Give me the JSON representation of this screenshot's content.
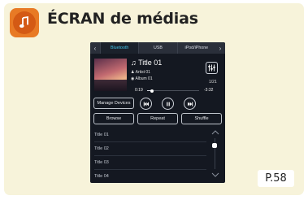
{
  "header": {
    "title": "ÉCRAN de médias",
    "icon": "music-note-icon",
    "icon_color": "#e87a25"
  },
  "screen": {
    "tabs": [
      {
        "label": "Bluetooth",
        "active": true
      },
      {
        "label": "USB",
        "active": false
      },
      {
        "label": "iPod/iPhone",
        "active": false
      }
    ],
    "now_playing": {
      "title": "Title 01",
      "artist": "Artist 01",
      "album": "Album 01",
      "track_position": "1/21",
      "elapsed": "0:19",
      "remaining": "-3:32",
      "progress": 0.09
    },
    "controls": {
      "manage_devices": "Manage Devices",
      "browse": "Browse",
      "repeat": "Repeat",
      "shuffle": "Shuffle"
    },
    "list": [
      "Title 01",
      "Title 02",
      "Title 03",
      "Title 04"
    ],
    "accent_color": "#41c3e8"
  },
  "page_ref": "P.58"
}
